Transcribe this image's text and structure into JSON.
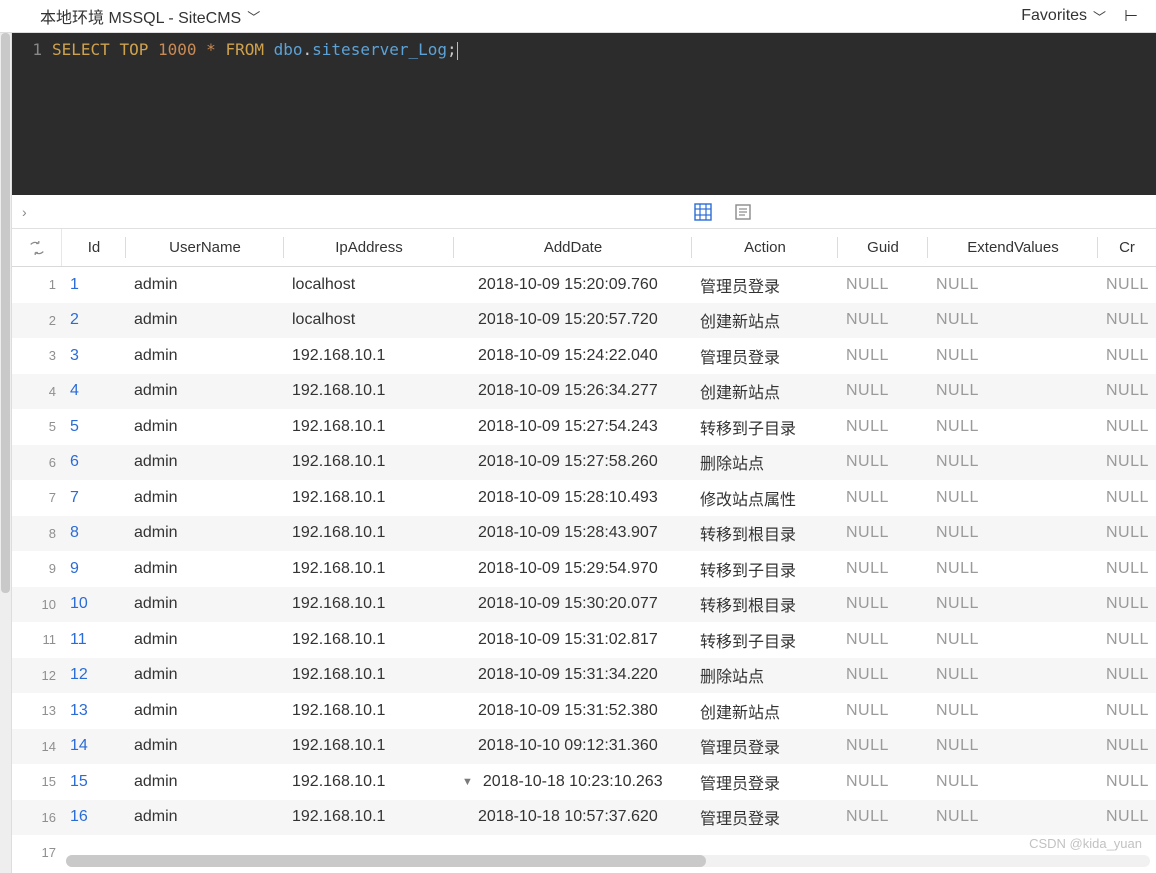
{
  "toolbar": {
    "connection_label": "本地环境 MSSQL - SiteCMS",
    "favorites_label": "Favorites",
    "right_more_glyph": "⊢"
  },
  "editor": {
    "line_num": "1",
    "tokens": {
      "select": "SELECT",
      "top": "TOP",
      "limit": "1000",
      "star": "*",
      "from": "FROM",
      "schema": "dbo",
      "dot": ".",
      "table": "siteserver_Log",
      "semi": ";"
    }
  },
  "midbar": {
    "chev": "›"
  },
  "columns": [
    "Id",
    "UserName",
    "IpAddress",
    "AddDate",
    "Action",
    "Guid",
    "ExtendValues",
    "Cr"
  ],
  "rows": [
    {
      "n": 1,
      "Id": "1",
      "UserName": "admin",
      "IpAddress": "localhost",
      "AddDate": "2018-10-09 15:20:09.760",
      "Action": "管理员登录",
      "Guid": "NULL",
      "ExtendValues": "NULL",
      "Cr": "NULL"
    },
    {
      "n": 2,
      "Id": "2",
      "UserName": "admin",
      "IpAddress": "localhost",
      "AddDate": "2018-10-09 15:20:57.720",
      "Action": "创建新站点",
      "Guid": "NULL",
      "ExtendValues": "NULL",
      "Cr": "NULL"
    },
    {
      "n": 3,
      "Id": "3",
      "UserName": "admin",
      "IpAddress": "192.168.10.1",
      "AddDate": "2018-10-09 15:24:22.040",
      "Action": "管理员登录",
      "Guid": "NULL",
      "ExtendValues": "NULL",
      "Cr": "NULL"
    },
    {
      "n": 4,
      "Id": "4",
      "UserName": "admin",
      "IpAddress": "192.168.10.1",
      "AddDate": "2018-10-09 15:26:34.277",
      "Action": "创建新站点",
      "Guid": "NULL",
      "ExtendValues": "NULL",
      "Cr": "NULL"
    },
    {
      "n": 5,
      "Id": "5",
      "UserName": "admin",
      "IpAddress": "192.168.10.1",
      "AddDate": "2018-10-09 15:27:54.243",
      "Action": "转移到子目录",
      "Guid": "NULL",
      "ExtendValues": "NULL",
      "Cr": "NULL"
    },
    {
      "n": 6,
      "Id": "6",
      "UserName": "admin",
      "IpAddress": "192.168.10.1",
      "AddDate": "2018-10-09 15:27:58.260",
      "Action": "删除站点",
      "Guid": "NULL",
      "ExtendValues": "NULL",
      "Cr": "NULL"
    },
    {
      "n": 7,
      "Id": "7",
      "UserName": "admin",
      "IpAddress": "192.168.10.1",
      "AddDate": "2018-10-09 15:28:10.493",
      "Action": "修改站点属性",
      "Guid": "NULL",
      "ExtendValues": "NULL",
      "Cr": "NULL"
    },
    {
      "n": 8,
      "Id": "8",
      "UserName": "admin",
      "IpAddress": "192.168.10.1",
      "AddDate": "2018-10-09 15:28:43.907",
      "Action": "转移到根目录",
      "Guid": "NULL",
      "ExtendValues": "NULL",
      "Cr": "NULL"
    },
    {
      "n": 9,
      "Id": "9",
      "UserName": "admin",
      "IpAddress": "192.168.10.1",
      "AddDate": "2018-10-09 15:29:54.970",
      "Action": "转移到子目录",
      "Guid": "NULL",
      "ExtendValues": "NULL",
      "Cr": "NULL"
    },
    {
      "n": 10,
      "Id": "10",
      "UserName": "admin",
      "IpAddress": "192.168.10.1",
      "AddDate": "2018-10-09 15:30:20.077",
      "Action": "转移到根目录",
      "Guid": "NULL",
      "ExtendValues": "NULL",
      "Cr": "NULL"
    },
    {
      "n": 11,
      "Id": "11",
      "UserName": "admin",
      "IpAddress": "192.168.10.1",
      "AddDate": "2018-10-09 15:31:02.817",
      "Action": "转移到子目录",
      "Guid": "NULL",
      "ExtendValues": "NULL",
      "Cr": "NULL"
    },
    {
      "n": 12,
      "Id": "12",
      "UserName": "admin",
      "IpAddress": "192.168.10.1",
      "AddDate": "2018-10-09 15:31:34.220",
      "Action": "删除站点",
      "Guid": "NULL",
      "ExtendValues": "NULL",
      "Cr": "NULL"
    },
    {
      "n": 13,
      "Id": "13",
      "UserName": "admin",
      "IpAddress": "192.168.10.1",
      "AddDate": "2018-10-09 15:31:52.380",
      "Action": "创建新站点",
      "Guid": "NULL",
      "ExtendValues": "NULL",
      "Cr": "NULL"
    },
    {
      "n": 14,
      "Id": "14",
      "UserName": "admin",
      "IpAddress": "192.168.10.1",
      "AddDate": "2018-10-10 09:12:31.360",
      "Action": "管理员登录",
      "Guid": "NULL",
      "ExtendValues": "NULL",
      "Cr": "NULL"
    },
    {
      "n": 15,
      "Id": "15",
      "UserName": "admin",
      "IpAddress": "192.168.10.1",
      "AddDate": "2018-10-18 10:23:10.263",
      "Action": "管理员登录",
      "Guid": "NULL",
      "ExtendValues": "NULL",
      "Cr": "NULL",
      "dd": true
    },
    {
      "n": 16,
      "Id": "16",
      "UserName": "admin",
      "IpAddress": "192.168.10.1",
      "AddDate": "2018-10-18 10:57:37.620",
      "Action": "管理员登录",
      "Guid": "NULL",
      "ExtendValues": "NULL",
      "Cr": "NULL"
    }
  ],
  "row17": "17",
  "watermark": "CSDN @kida_yuan"
}
